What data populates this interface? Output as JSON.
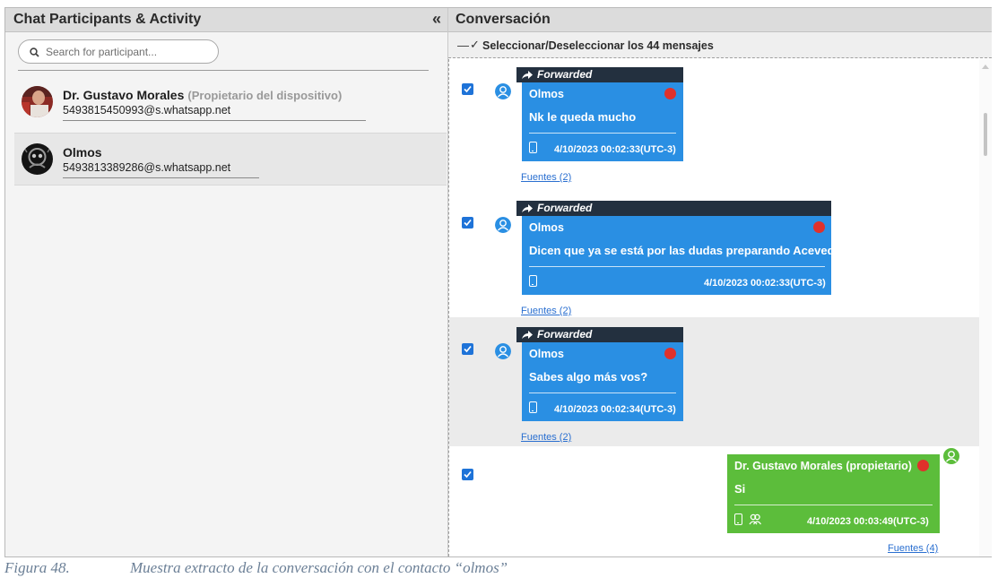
{
  "left_panel": {
    "title": "Chat Participants & Activity",
    "collapse_label": "«",
    "search_placeholder": "Search for participant...",
    "participants": [
      {
        "name": "Dr. Gustavo Morales",
        "role": "(Propietario del dispositivo)",
        "phone": "5493815450993@s.whatsapp.net"
      },
      {
        "name": "Olmos",
        "role": "",
        "phone": "5493813389286@s.whatsapp.net"
      }
    ]
  },
  "right_panel": {
    "title": "Conversación",
    "select_dash": "—",
    "select_check": "✓",
    "select_all_label": "Seleccionar/Deseleccionar los 44 mensajes",
    "messages": [
      {
        "forwarded_label": "Forwarded",
        "sender": "Olmos",
        "text": "Nk le queda mucho",
        "timestamp": "4/10/2023 00:02:33(UTC-3)",
        "sources": "Fuentes (2)"
      },
      {
        "forwarded_label": "Forwarded",
        "sender": "Olmos",
        "text": "Dicen que ya se está por las dudas preparando Acevedo",
        "timestamp": "4/10/2023 00:02:33(UTC-3)",
        "sources": "Fuentes (2)"
      },
      {
        "forwarded_label": "Forwarded",
        "sender": "Olmos",
        "text": "Sabes algo más vos?",
        "timestamp": "4/10/2023 00:02:34(UTC-3)",
        "sources": "Fuentes (2)"
      },
      {
        "forwarded_label": "",
        "sender": "Dr. Gustavo Morales (propietario)",
        "text": "Si",
        "timestamp": "4/10/2023 00:03:49(UTC-3)",
        "sources": "Fuentes (4)"
      }
    ]
  },
  "caption": {
    "number": "Figura 48.",
    "text": "Muestra extracto de la conversación con el contacto “olmos”"
  },
  "colors": {
    "incoming_bubble": "#2a8fe3",
    "outgoing_bubble": "#5cbd3b",
    "forwarded_bar": "#23303f",
    "status_dot": "#e0312b",
    "checkbox": "#1e73d8",
    "link": "#2a6fd0"
  },
  "icons": {
    "search": "search-icon",
    "forward": "forward-arrow-icon",
    "user": "user-icon",
    "device": "phone-icon",
    "group": "participants-icon",
    "checkbox": "checkbox-checked-icon"
  }
}
